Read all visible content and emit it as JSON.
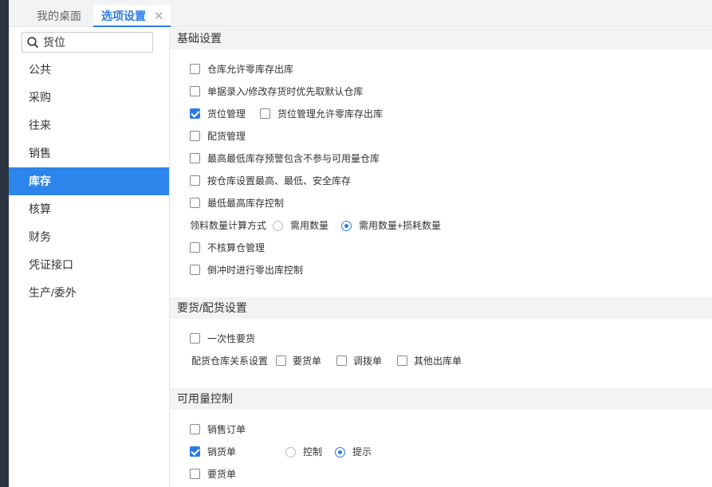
{
  "tabs": [
    {
      "label": "我的桌面"
    },
    {
      "label": "选项设置",
      "close": "✕"
    }
  ],
  "sidebar": {
    "search_value": "货位",
    "items": [
      "公共",
      "采购",
      "往来",
      "销售",
      "库存",
      "核算",
      "财务",
      "凭证接口",
      "生产/委外"
    ],
    "active": "库存"
  },
  "sections": {
    "basic": {
      "title": "基础设置",
      "options": [
        {
          "label": "仓库允许零库存出库",
          "checked": false
        },
        {
          "label": "单据录入/修改存货时优先取默认仓库",
          "checked": false
        },
        {
          "label": "货位管理",
          "checked": true
        },
        {
          "label": "货位管理允许零库存出库",
          "checked": false
        },
        {
          "label": "配货管理",
          "checked": false
        },
        {
          "label": "最高最低库存预警包含不参与可用量仓库",
          "checked": false
        },
        {
          "label": "按仓库设置最高、最低、安全库存",
          "checked": false
        },
        {
          "label": "最低最高库存控制",
          "checked": false
        }
      ],
      "calc_label": "领料数量计算方式",
      "calc_options": [
        {
          "label": "需用数量",
          "selected": false
        },
        {
          "label": "需用数量+损耗数量",
          "selected": true
        }
      ],
      "options2": [
        {
          "label": "不核算仓管理",
          "checked": false
        },
        {
          "label": "倒冲时进行零出库控制",
          "checked": false
        }
      ]
    },
    "demand": {
      "title": "要货/配货设置",
      "one_time": {
        "label": "一次性要货",
        "checked": false
      },
      "relation_label": "配货仓库关系设置",
      "relation_options": [
        {
          "label": "要货单",
          "checked": false
        },
        {
          "label": "调拨单",
          "checked": false
        },
        {
          "label": "其他出库单",
          "checked": false
        }
      ]
    },
    "available": {
      "title": "可用量控制",
      "options": [
        {
          "label": "销售订单",
          "checked": false
        },
        {
          "label": "销货单",
          "checked": true
        },
        {
          "label": "要货单",
          "checked": false
        }
      ],
      "mode_options": [
        {
          "label": "控制",
          "selected": false
        },
        {
          "label": "提示",
          "selected": true
        }
      ]
    }
  }
}
